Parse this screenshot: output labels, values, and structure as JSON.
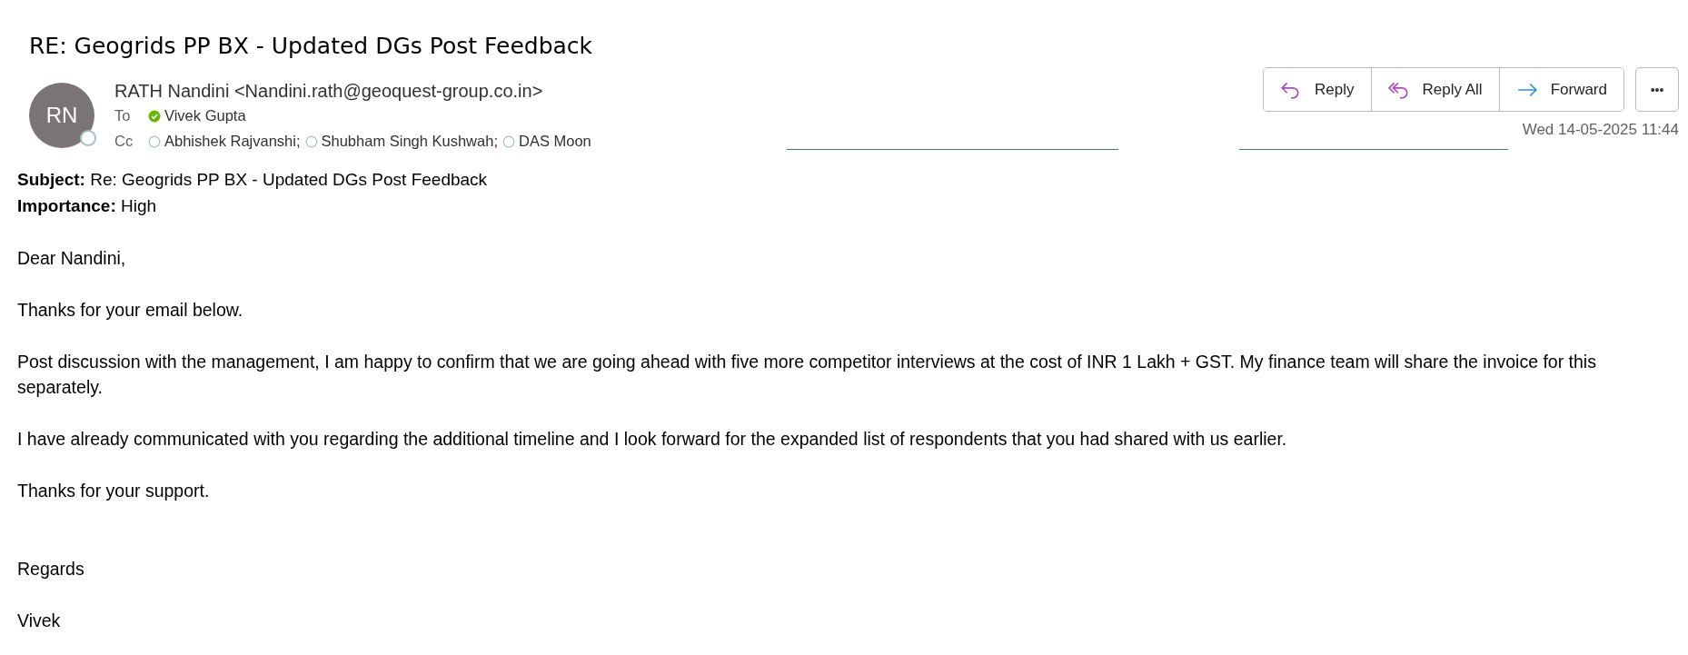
{
  "title": "RE: Geogrids PP BX - Updated DGs Post Feedback",
  "sender": {
    "initials": "RN",
    "name": "RATH Nandini",
    "email": "<Nandini.rath@geoquest-group.co.in>",
    "available": false
  },
  "to": {
    "label": "To",
    "recipients": [
      {
        "name": "Vivek Gupta",
        "available": true
      }
    ]
  },
  "cc": {
    "label": "Cc",
    "recipients": [
      {
        "name": "Abhishek Rajvanshi;",
        "available": false
      },
      {
        "name": "Shubham Singh Kushwah;",
        "available": false
      },
      {
        "name": "DAS Moon",
        "available": false
      }
    ]
  },
  "actions": [
    {
      "kind": "reply",
      "label": "Reply"
    },
    {
      "kind": "reply-all",
      "label": "Reply All"
    },
    {
      "kind": "forward",
      "label": "Forward"
    }
  ],
  "more_button": "•••",
  "date": "Wed 14-05-2025 11:44",
  "fields": [
    {
      "label": "Subject:",
      "value": "Re: Geogrids PP BX - Updated DGs Post Feedback"
    },
    {
      "label": "Importance:",
      "value": "High"
    }
  ],
  "body": [
    {
      "kind": "paragraph",
      "text": "Dear Nandini,"
    },
    {
      "kind": "paragraph",
      "text": "Thanks for your email below."
    },
    {
      "kind": "paragraph",
      "text": "Post discussion with the management, I am happy to confirm that we are going ahead with five more competitor interviews at the cost of INR 1 Lakh + GST. My finance team will share the invoice for this separately."
    },
    {
      "kind": "paragraph",
      "text": "I have already communicated with you regarding the additional timeline and I look forward for the expanded list of respondents that you had shared with us earlier."
    },
    {
      "kind": "paragraph",
      "text": "Thanks for your support."
    },
    {
      "kind": "closing",
      "text": "Regards"
    },
    {
      "kind": "paragraph",
      "text": "Vivek"
    }
  ]
}
